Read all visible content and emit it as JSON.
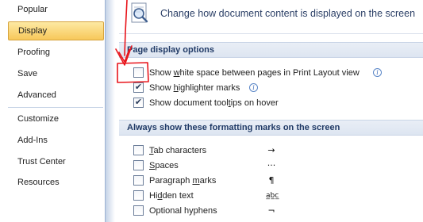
{
  "sidebar": {
    "items": [
      {
        "label": "Popular",
        "selected": false
      },
      {
        "label": "Display",
        "selected": true
      },
      {
        "label": "Proofing",
        "selected": false
      },
      {
        "label": "Save",
        "selected": false
      },
      {
        "label": "Advanced",
        "selected": false
      },
      {
        "label": "Customize",
        "selected": false
      },
      {
        "label": "Add-Ins",
        "selected": false
      },
      {
        "label": "Trust Center",
        "selected": false
      },
      {
        "label": "Resources",
        "selected": false
      }
    ]
  },
  "header": {
    "title": "Change how document content is displayed on the screen",
    "icon": "magnifier-document-icon"
  },
  "page_display": {
    "section_title": "Page display options",
    "options": [
      {
        "label_pre": "Show ",
        "label_key": "w",
        "label_post": "hite space between pages in Print Layout view",
        "checked": false,
        "info": true
      },
      {
        "label_pre": "Show ",
        "label_key": "h",
        "label_post": "ighlighter marks",
        "checked": true,
        "info": true
      },
      {
        "label_pre": "Show document tool",
        "label_key": "t",
        "label_post": "ips on hover",
        "checked": true,
        "info": false
      }
    ]
  },
  "formatting_marks": {
    "section_title": "Always show these formatting marks on the screen",
    "options": [
      {
        "label_pre": "",
        "label_key": "T",
        "label_post": "ab characters",
        "symbol": "→",
        "checked": false
      },
      {
        "label_pre": "",
        "label_key": "S",
        "label_post": "paces",
        "symbol": "···",
        "checked": false
      },
      {
        "label_pre": "Paragraph ",
        "label_key": "m",
        "label_post": "arks",
        "symbol": "¶",
        "checked": false
      },
      {
        "label_pre": "Hi",
        "label_key": "d",
        "label_post": "den text",
        "symbol": "a̲b̲c̲",
        "checked": false
      },
      {
        "label_pre": "Optional hyphens",
        "label_key": "",
        "label_post": "",
        "symbol": "¬",
        "checked": false
      }
    ]
  },
  "colors": {
    "accent": "#f7c85a",
    "section_bg": "#dde5f1",
    "annotation": "#e8141b"
  }
}
